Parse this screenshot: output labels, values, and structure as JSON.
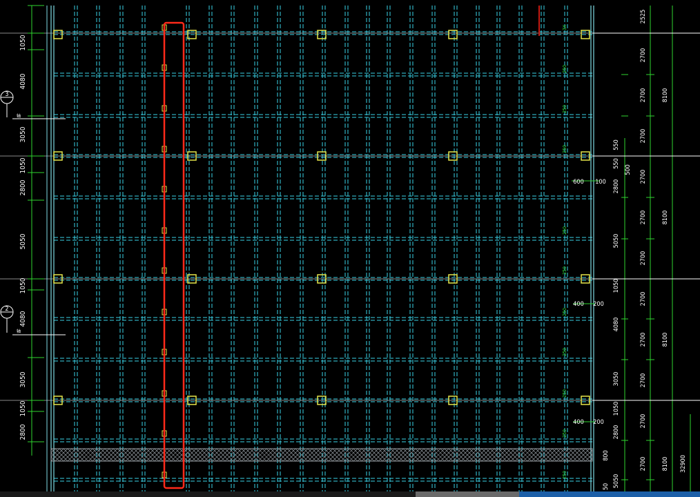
{
  "colors": {
    "background": "#000000",
    "grid_main": "#3ad3e8",
    "grid_dash": "#3ad3e8",
    "wall_line": "#7fdde6",
    "column_box": "#e6e64a",
    "dimension": "#2fd62f",
    "text": "#ffffff",
    "highlight": "#ff2a1a",
    "hatch": "#9aa0a6",
    "gray_line": "#8a8a8a",
    "status_blue": "#1c5fa8",
    "status_gray": "#6a6a6a"
  },
  "left_dimensions": [
    "1050",
    "4080",
    "3050",
    "1050",
    "2800",
    "5050",
    "1050",
    "4080",
    "3050",
    "1050",
    "2800"
  ],
  "axis_markers": [
    {
      "number": "3",
      "label": "轴"
    },
    {
      "number": "2",
      "label": "轴"
    }
  ],
  "right_inner_dimensions": [
    "550",
    "550",
    "500",
    "2800",
    "5050",
    "1050",
    "4080",
    "3050",
    "1050",
    "2800",
    "800",
    "5050",
    "50"
  ],
  "right_col1_dimensions": [
    "2525",
    "2700",
    "2700",
    "2700",
    "2700",
    "2700",
    "2700",
    "2700",
    "2700",
    "2700",
    "2700",
    "2700"
  ],
  "right_col2_dimensions": [
    "8100",
    "8100",
    "8100",
    "8100"
  ],
  "right_col3_dimensions": [
    "32900"
  ],
  "local_dimensions": [
    "600",
    "100",
    "400",
    "200",
    "400",
    "200"
  ],
  "beam_tags": [
    "3X",
    "250",
    "250",
    "250",
    "250",
    "250",
    "250",
    "250",
    "250",
    "250",
    "250",
    "250"
  ]
}
